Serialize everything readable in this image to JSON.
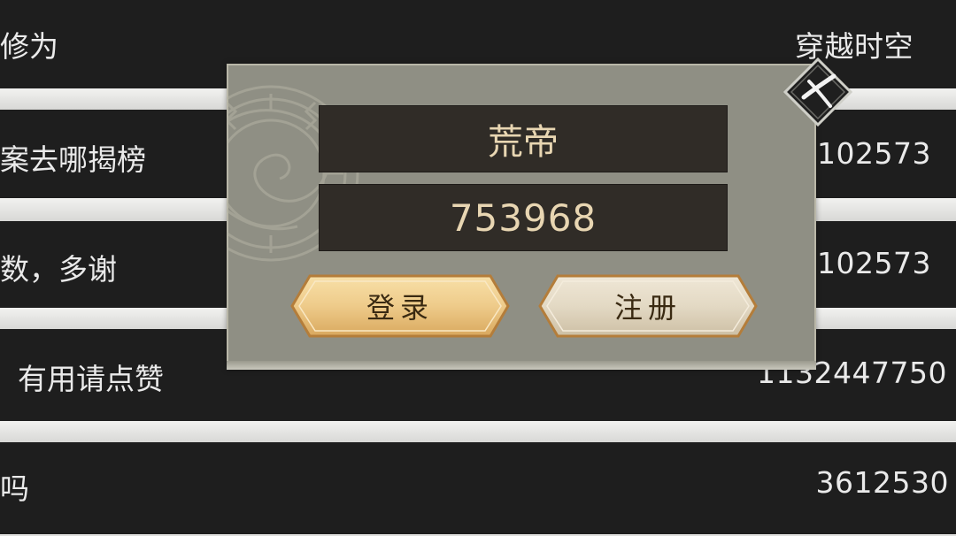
{
  "background_rows": [
    {
      "left": "修为",
      "right": "穿越时空"
    },
    {
      "left": "案去哪揭榜",
      "right": "151102573"
    },
    {
      "left": "数，多谢",
      "right": "151102573"
    },
    {
      "left": "有用请点赞",
      "right": "1132447750"
    },
    {
      "left": "吗",
      "right": "3612530"
    }
  ],
  "login_dialog": {
    "username": "荒帝",
    "password": "753968",
    "login_label": "登录",
    "register_label": "注册",
    "close_icon": "close-x-icon",
    "emblem_icon": "dragon-seal-emblem"
  },
  "colors": {
    "row_bg": "#1e1e1e",
    "dialog_bg": "#8f8f84",
    "field_bg": "#302c27",
    "field_text": "#e8d6b2",
    "login_btn": "#eecb8a",
    "register_btn": "#e3d9c4"
  }
}
